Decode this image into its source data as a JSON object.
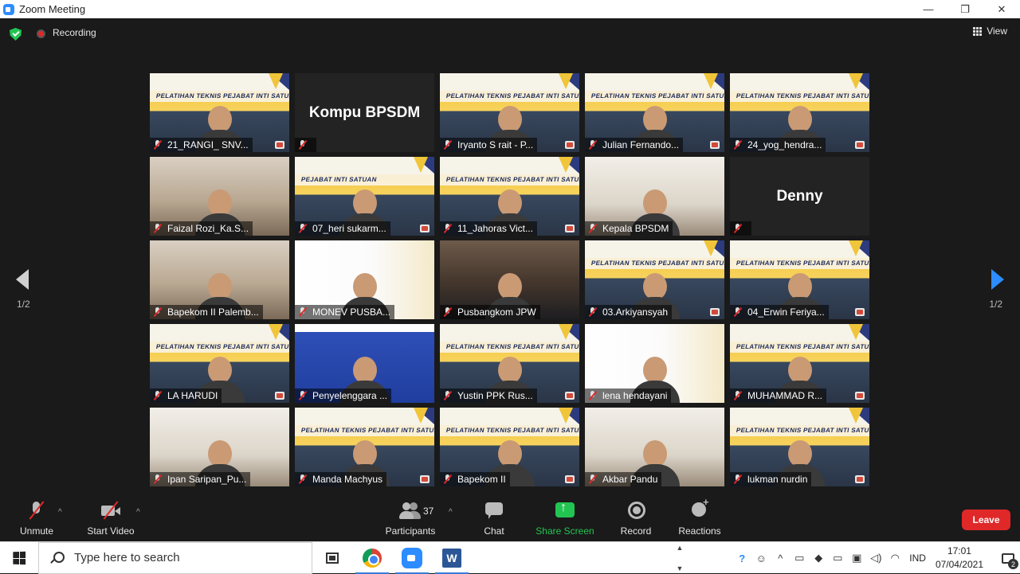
{
  "window": {
    "title": "Zoom Meeting",
    "minimize": "—",
    "maximize": "❐",
    "close": "✕"
  },
  "topbar": {
    "recording_label": "Recording",
    "view_label": "View"
  },
  "pagination": {
    "left": "1/2",
    "right": "1/2"
  },
  "tiles": [
    {
      "name": "21_RANGI_ SNV...",
      "type": "banner",
      "banner_text": "PELATIHAN TEKNIS PEJABAT INTI SATUAN KER"
    },
    {
      "name": "Kompu BPSDM",
      "type": "blank"
    },
    {
      "name": "Iryanto S rait - P...",
      "type": "banner",
      "banner_text": "PELATIHAN TEKNIS PEJABAT INTI SATUAN"
    },
    {
      "name": "Julian Fernando...",
      "type": "banner",
      "banner_text": "PELATIHAN TEKNIS PEJABAT INTI SATUAN"
    },
    {
      "name": "24_yog_hendra...",
      "type": "banner",
      "banner_text": "PELATIHAN TEKNIS PEJABAT INTI SATUAN"
    },
    {
      "name": "Faizal Rozi_Ka.S...",
      "type": "room"
    },
    {
      "name": "07_heri sukarm...",
      "type": "banner",
      "banner_text": "PEJABAT INTI SATUAN"
    },
    {
      "name": "11_Jahoras Vict...",
      "type": "banner",
      "banner_text": "PELATIHAN TEKNIS PEJABAT INTI SATUAN"
    },
    {
      "name": "Kepala BPSDM",
      "type": "room2"
    },
    {
      "name": "Denny",
      "type": "blank"
    },
    {
      "name": "Bapekom II Palemb...",
      "type": "room"
    },
    {
      "name": "MONEV PUSBA...",
      "type": "slide"
    },
    {
      "name": "Pusbangkom JPW",
      "type": "room3",
      "active": true
    },
    {
      "name": "03.Arkiyansyah",
      "type": "banner",
      "banner_text": "PELATIHAN TEKNIS PEJABAT INTI SATUAN"
    },
    {
      "name": "04_Erwin Feriya...",
      "type": "banner",
      "banner_text": "PELATIHAN TEKNIS PEJABAT INTI SATUAN"
    },
    {
      "name": "LA HARUDI",
      "type": "banner",
      "banner_text": "PELATIHAN TEKNIS PEJABAT INTI SATUAN"
    },
    {
      "name": "Penyelenggara ...",
      "type": "bluebg"
    },
    {
      "name": "Yustin PPK Rus...",
      "type": "banner",
      "banner_text": "PELATIHAN TEKNIS PEJABAT INTI SATUAN"
    },
    {
      "name": "lena hendayani",
      "type": "slide"
    },
    {
      "name": "MUHAMMAD R...",
      "type": "banner",
      "banner_text": "PELATIHAN TEKNIS PEJABAT INTI SATUAN"
    },
    {
      "name": "Ipan Saripan_Pu...",
      "type": "room2"
    },
    {
      "name": "Manda Machyus",
      "type": "banner",
      "banner_text": "PELATIHAN TEKNIS PEJABAT INTI SATUAN"
    },
    {
      "name": "Bapekom II",
      "type": "banner",
      "banner_text": "PELATIHAN TEKNIS PEJABAT INTI SATUAN"
    },
    {
      "name": "Akbar Pandu",
      "type": "room2"
    },
    {
      "name": "lukman nurdin",
      "type": "banner",
      "banner_text": "PELATIHAN TEKNIS PEJABAT INTI SATUAN"
    }
  ],
  "toolbar": {
    "unmute": "Unmute",
    "start_video": "Start Video",
    "participants": "Participants",
    "participants_count": "37",
    "chat": "Chat",
    "share_screen": "Share Screen",
    "record": "Record",
    "reactions": "Reactions",
    "leave": "Leave",
    "caret": "^"
  },
  "taskbar": {
    "search_placeholder": "Type here to search",
    "language": "IND",
    "time": "17:01",
    "date": "07/04/2021",
    "notification_count": "2",
    "word_letter": "W"
  },
  "colors": {
    "accent": "#2d8cff",
    "share_green": "#23c552",
    "leave_red": "#e02828",
    "active_speaker": "#b8d43a"
  }
}
